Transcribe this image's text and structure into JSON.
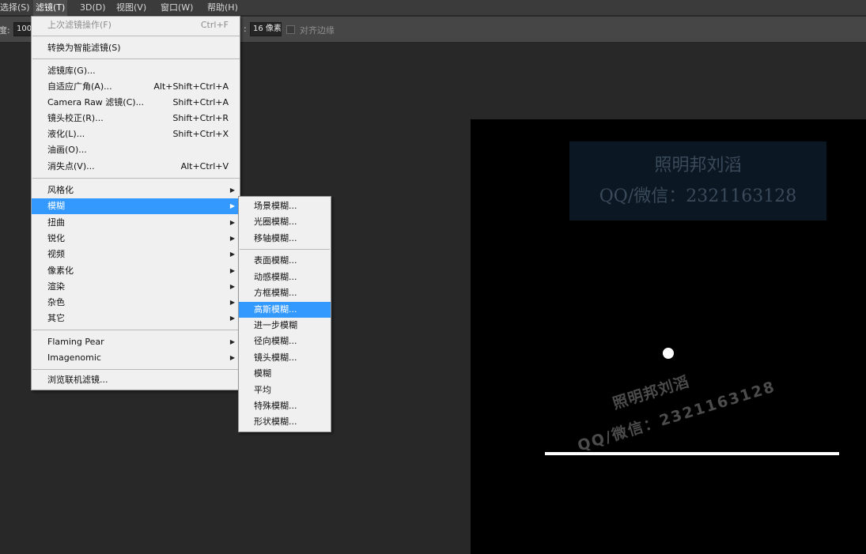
{
  "menubar": {
    "items": [
      {
        "label": "选择(S)"
      },
      {
        "label": "滤镜(T)"
      },
      {
        "label": "3D(D)"
      },
      {
        "label": "视图(V)"
      },
      {
        "label": "窗口(W)"
      },
      {
        "label": "帮助(H)"
      }
    ]
  },
  "options_bar": {
    "left_label": "度:",
    "left_value": "100",
    "sample_label": ":",
    "sample_value": "16 像素",
    "align_edges_label": "对齐边缘"
  },
  "filter_menu": {
    "items": [
      {
        "label": "上次滤镜操作(F)",
        "shortcut": "Ctrl+F",
        "disabled": true
      },
      {
        "label": "转换为智能滤镜(S)"
      },
      {
        "label": "滤镜库(G)..."
      },
      {
        "label": "自适应广角(A)...",
        "shortcut": "Alt+Shift+Ctrl+A"
      },
      {
        "label": "Camera Raw 滤镜(C)...",
        "shortcut": "Shift+Ctrl+A"
      },
      {
        "label": "镜头校正(R)...",
        "shortcut": "Shift+Ctrl+R"
      },
      {
        "label": "液化(L)...",
        "shortcut": "Shift+Ctrl+X"
      },
      {
        "label": "油画(O)..."
      },
      {
        "label": "消失点(V)...",
        "shortcut": "Alt+Ctrl+V"
      },
      {
        "label": "风格化",
        "submenu": true
      },
      {
        "label": "模糊",
        "submenu": true,
        "highlighted": true
      },
      {
        "label": "扭曲",
        "submenu": true
      },
      {
        "label": "锐化",
        "submenu": true
      },
      {
        "label": "视频",
        "submenu": true
      },
      {
        "label": "像素化",
        "submenu": true
      },
      {
        "label": "渲染",
        "submenu": true
      },
      {
        "label": "杂色",
        "submenu": true
      },
      {
        "label": "其它",
        "submenu": true
      },
      {
        "label": "Flaming Pear",
        "submenu": true
      },
      {
        "label": "Imagenomic",
        "submenu": true
      },
      {
        "label": "浏览联机滤镜..."
      }
    ]
  },
  "blur_submenu": {
    "items": [
      {
        "label": "场景模糊..."
      },
      {
        "label": "光圈模糊..."
      },
      {
        "label": "移轴模糊..."
      },
      {
        "label": "表面模糊..."
      },
      {
        "label": "动感模糊..."
      },
      {
        "label": "方框模糊..."
      },
      {
        "label": "高斯模糊...",
        "highlighted": true
      },
      {
        "label": "进一步模糊"
      },
      {
        "label": "径向模糊..."
      },
      {
        "label": "镜头模糊..."
      },
      {
        "label": "模糊"
      },
      {
        "label": "平均"
      },
      {
        "label": "特殊模糊..."
      },
      {
        "label": "形状模糊..."
      }
    ]
  },
  "canvas": {
    "watermark_top_line1": "照明邦刘滔",
    "watermark_top_line2": "QQ/微信：2321163128",
    "watermark_rot_line1": "照明邦刘滔",
    "watermark_rot_line2": "QQ/微信：2321163128"
  },
  "colors": {
    "highlight": "#3399ff",
    "menu_bg": "#f0f0f0",
    "workspace": "#282828"
  }
}
